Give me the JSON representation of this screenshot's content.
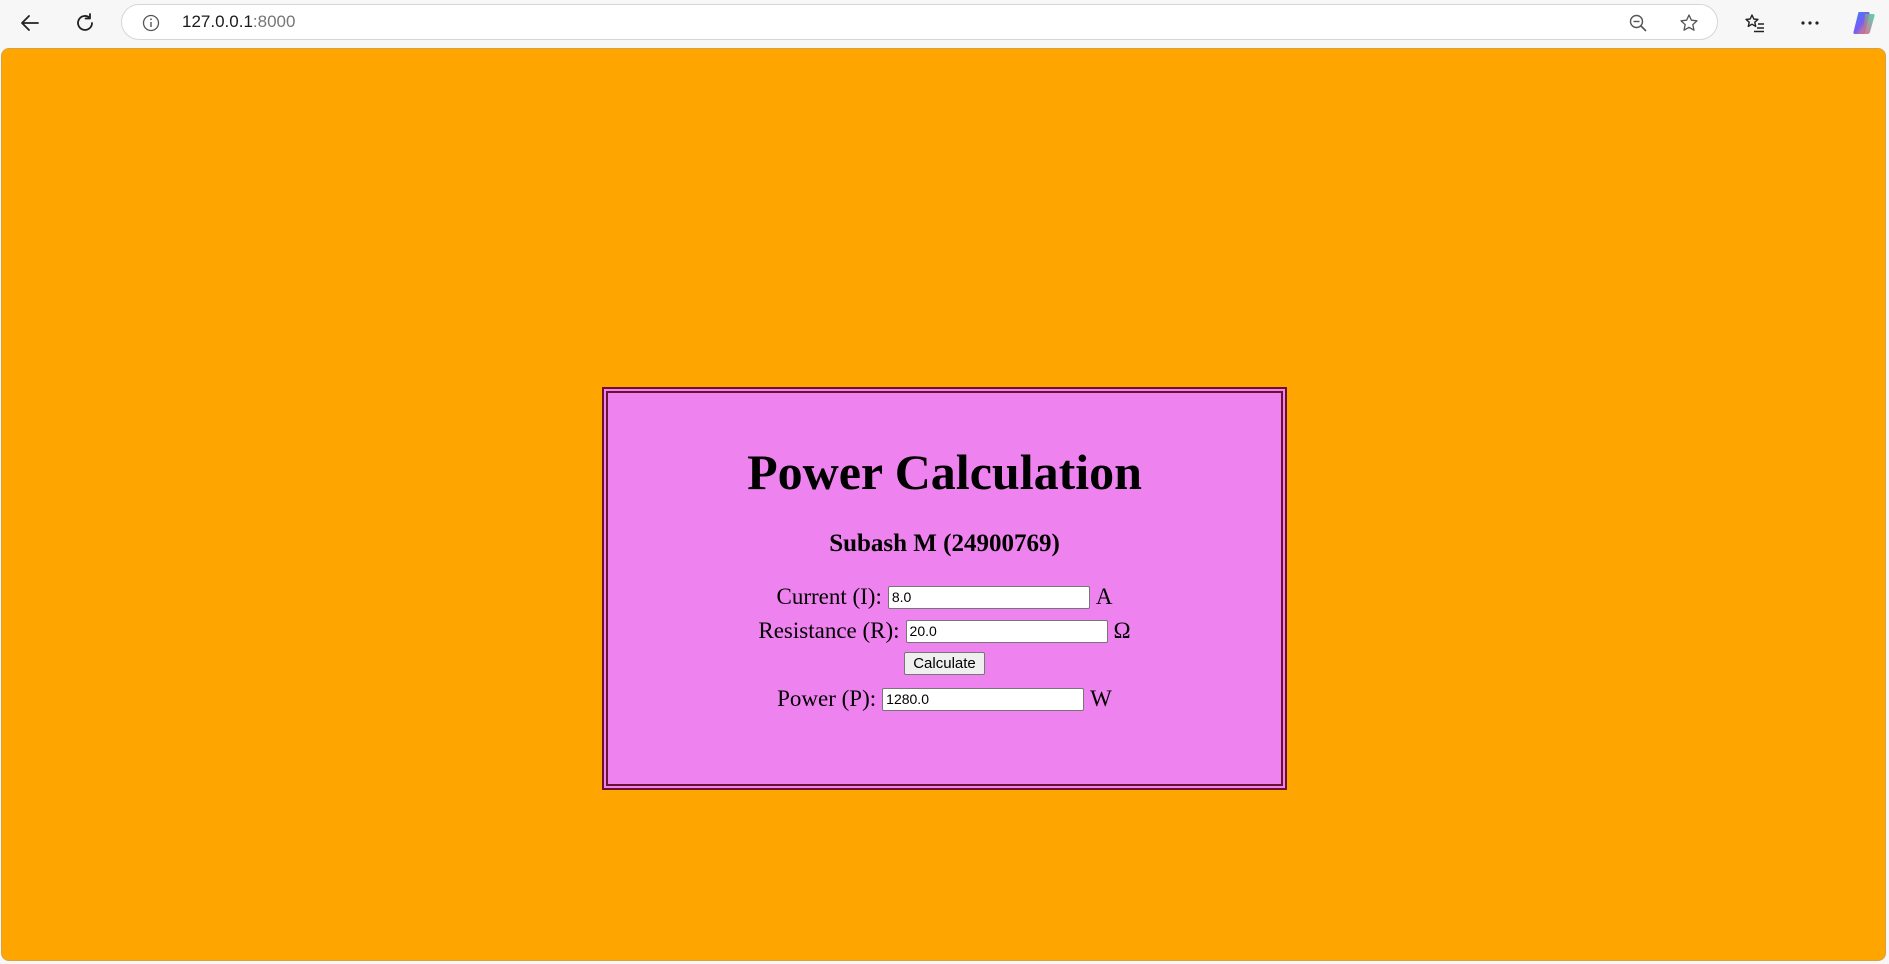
{
  "browser": {
    "url_host": "127.0.0.1",
    "url_port": ":8000"
  },
  "page": {
    "title": "Power Calculation",
    "subtitle": "Subash M (24900769)",
    "current": {
      "label": "Current (I):",
      "value": "8.0",
      "unit": "A"
    },
    "resistance": {
      "label": "Resistance (R):",
      "value": "20.0",
      "unit": "Ω"
    },
    "calculate_label": "Calculate",
    "power": {
      "label": "Power (P):",
      "value": "1280.0",
      "unit": "W"
    }
  },
  "colors": {
    "background": "#ffa500",
    "card": "#ee82ee",
    "card_border": "#6b1030"
  }
}
